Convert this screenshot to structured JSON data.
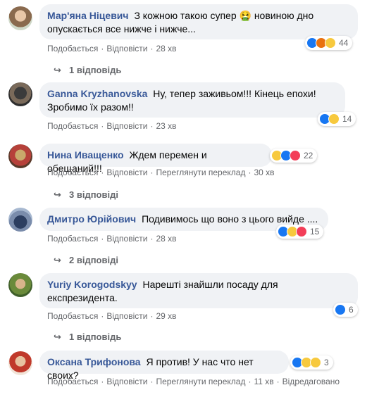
{
  "comments": [
    {
      "author": "Мар'яна Ніцевич",
      "text": "З кожною такою супер 🤮 новиною дно опускається все нижче і нижче...",
      "line1": "З кожною такою супер 🤮 новиною дно",
      "line2": "опускається все нижче і нижче...",
      "like": "Подобається",
      "reply": "Відповісти",
      "time": "28 хв",
      "reactions": "44",
      "replies": "1 відповідь"
    },
    {
      "author": "Ganna Kryzhanovska",
      "line1": "Ну, тепер заживьом!!! Кінець епохи!",
      "line2": "Зробимо їх разом!!",
      "like": "Подобається",
      "reply": "Відповісти",
      "time": "23 хв",
      "reactions": "14"
    },
    {
      "author": "Нина Иващенко",
      "line1": "Ждем перемен и обещаний!!!",
      "like": "Подобається",
      "reply": "Відповісти",
      "translate": "Переглянути переклад",
      "time": "30 хв",
      "reactions": "22",
      "replies": "3 відповіді"
    },
    {
      "author": "Дмитро Юрійович",
      "line1": "Подивимось що воно з цього вийде ....",
      "like": "Подобається",
      "reply": "Відповісти",
      "time": "28 хв",
      "reactions": "15",
      "replies": "2 відповіді"
    },
    {
      "author": "Yuriy Korogodskyy",
      "line1": "Нарешті знайшли посаду для",
      "line2": "експрезидента.",
      "like": "Подобається",
      "reply": "Відповісти",
      "time": "29 хв",
      "reactions": "6",
      "replies": "1 відповідь"
    },
    {
      "author": "Оксана Трифонова",
      "line1": "Я против! У нас что нет своих?",
      "like": "Подобається",
      "reply": "Відповісти",
      "translate": "Переглянути переклад",
      "time": "11 хв",
      "edited": "Відредаговано",
      "reactions": "3"
    }
  ],
  "separator": "·",
  "colors": {
    "link": "#385898",
    "bubble": "#f0f2f5",
    "meta": "#65676b",
    "like": "#1877f2"
  }
}
